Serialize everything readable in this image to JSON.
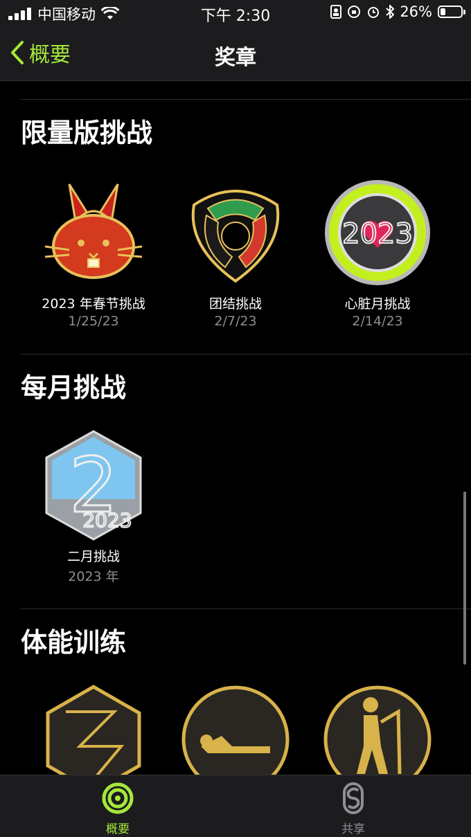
{
  "status_bar": {
    "carrier": "中国移动",
    "time": "下午 2:30",
    "battery": "26%",
    "battery_level": 0.26
  },
  "nav": {
    "back_label": "概要",
    "title": "奖章"
  },
  "sections": [
    {
      "title": "限量版挑战",
      "awards": [
        {
          "name": "2023 年春节挑战",
          "date": "1/25/23",
          "icon": "rabbit-medal-icon"
        },
        {
          "name": "团结挑战",
          "date": "2/7/23",
          "icon": "unity-hands-medal-icon"
        },
        {
          "name": "心脏月挑战",
          "date": "2/14/23",
          "icon": "heart-month-ring-medal-icon"
        }
      ]
    },
    {
      "title": "每月挑战",
      "awards": [
        {
          "name": "二月挑战",
          "date": "2023 年",
          "icon": "february-hexagon-medal-icon"
        }
      ]
    },
    {
      "title": "体能训练",
      "awards": [
        {
          "icon": "hiit-hexagon-medal-icon"
        },
        {
          "icon": "core-training-medal-icon"
        },
        {
          "icon": "elliptical-medal-icon"
        }
      ]
    }
  ],
  "tab_bar": {
    "tabs": [
      {
        "label": "概要",
        "icon": "activity-rings-icon",
        "active": true
      },
      {
        "label": "共享",
        "icon": "sharing-icon",
        "active": false
      }
    ]
  },
  "colors": {
    "accent": "#a5e83b",
    "secondary_text": "#8e8e93"
  }
}
